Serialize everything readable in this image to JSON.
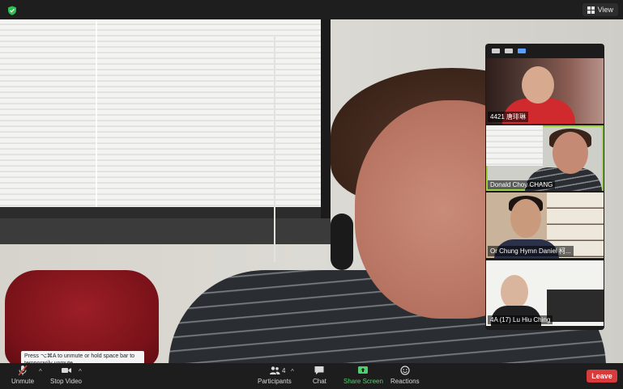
{
  "topbar": {
    "view_label": "View"
  },
  "gallery": {
    "tiles": [
      {
        "name": "4421 唐琲琳"
      },
      {
        "name": "Donald Choy CHANG"
      },
      {
        "name": "Or Chung Hymn Daniel 柯..."
      },
      {
        "name": "4A (17) Lu Hiu Ching"
      }
    ]
  },
  "tooltip": {
    "text": "Press ⌥⌘A to unmute or hold space bar to temporarily unmute."
  },
  "toolbar": {
    "unmute": "Unmute",
    "stop_video": "Stop Video",
    "participants": "Participants",
    "participants_count": "4",
    "chat": "Chat",
    "share_screen": "Share Screen",
    "reactions": "Reactions",
    "leave": "Leave"
  },
  "colors": {
    "share_green": "#4fd06c",
    "leave_red": "#d73b3b",
    "active_speaker": "#9ad23c"
  }
}
